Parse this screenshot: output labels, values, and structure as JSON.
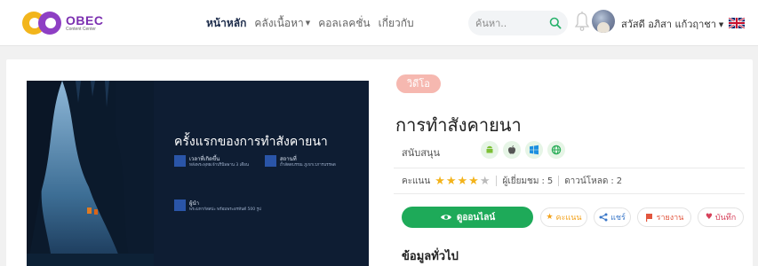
{
  "header": {
    "logo": {
      "text": "OBEC",
      "subtext": "Content Center"
    },
    "nav": [
      {
        "label": "หน้าหลัก",
        "active": true,
        "dropdown": false
      },
      {
        "label": "คลังเนื้อหา",
        "active": false,
        "dropdown": true
      },
      {
        "label": "คอลเลคชั่น",
        "active": false,
        "dropdown": false
      },
      {
        "label": "เกี่ยวกับ",
        "active": false,
        "dropdown": false
      }
    ],
    "search": {
      "placeholder": "ค้นหา..",
      "icon": "search-icon"
    },
    "user": {
      "name": "สวัสดี อภิสา แก้วฤาชา",
      "avatar": "avatar"
    },
    "language": {
      "icon": "uk-flag-icon"
    }
  },
  "media": {
    "type_badge": "วิดีโอ",
    "title": "การทำสังคายนา",
    "support_label": "สนับสนุน",
    "platforms": [
      "android-icon",
      "apple-icon",
      "windows-icon",
      "web-icon"
    ],
    "rating_label": "คะแนน",
    "rating_value": 4,
    "rating_max": 5,
    "views_label": "ผู้เยี่ยมชม",
    "views": "5",
    "downloads_label": "ดาวน์โหลด",
    "downloads": "2",
    "actions": {
      "online": "ดูออนไลน์",
      "rate": "คะแนน",
      "share": "แชร์",
      "report": "รายงาน",
      "save": "บันทึก"
    },
    "general_heading": "ข้อมูลทั่วไป"
  },
  "thumbnail": {
    "title": "ครั้งแรกของการทำสังคายนา",
    "blocks": [
      {
        "head": "เวลาที่เกิดขึ้น",
        "detail": "หลังพระพุทธเจ้าปรินิพพาน 3 เดือน"
      },
      {
        "head": "สถานที่",
        "detail": "ถ้ำสัตตบรรณ ภูเขาเวภารบรรพต"
      },
      {
        "head": "ผู้นำ",
        "detail": "พระมหากัสสปะ พร้อมพระอรหันต์ 500 รูป"
      }
    ]
  },
  "colors": {
    "accent_green": "#1eaa59",
    "badge_pink": "#f6b8b0",
    "star": "#f3b31b",
    "brand_purple": "#7b2fb0",
    "brand_yellow": "#f2b51c"
  }
}
